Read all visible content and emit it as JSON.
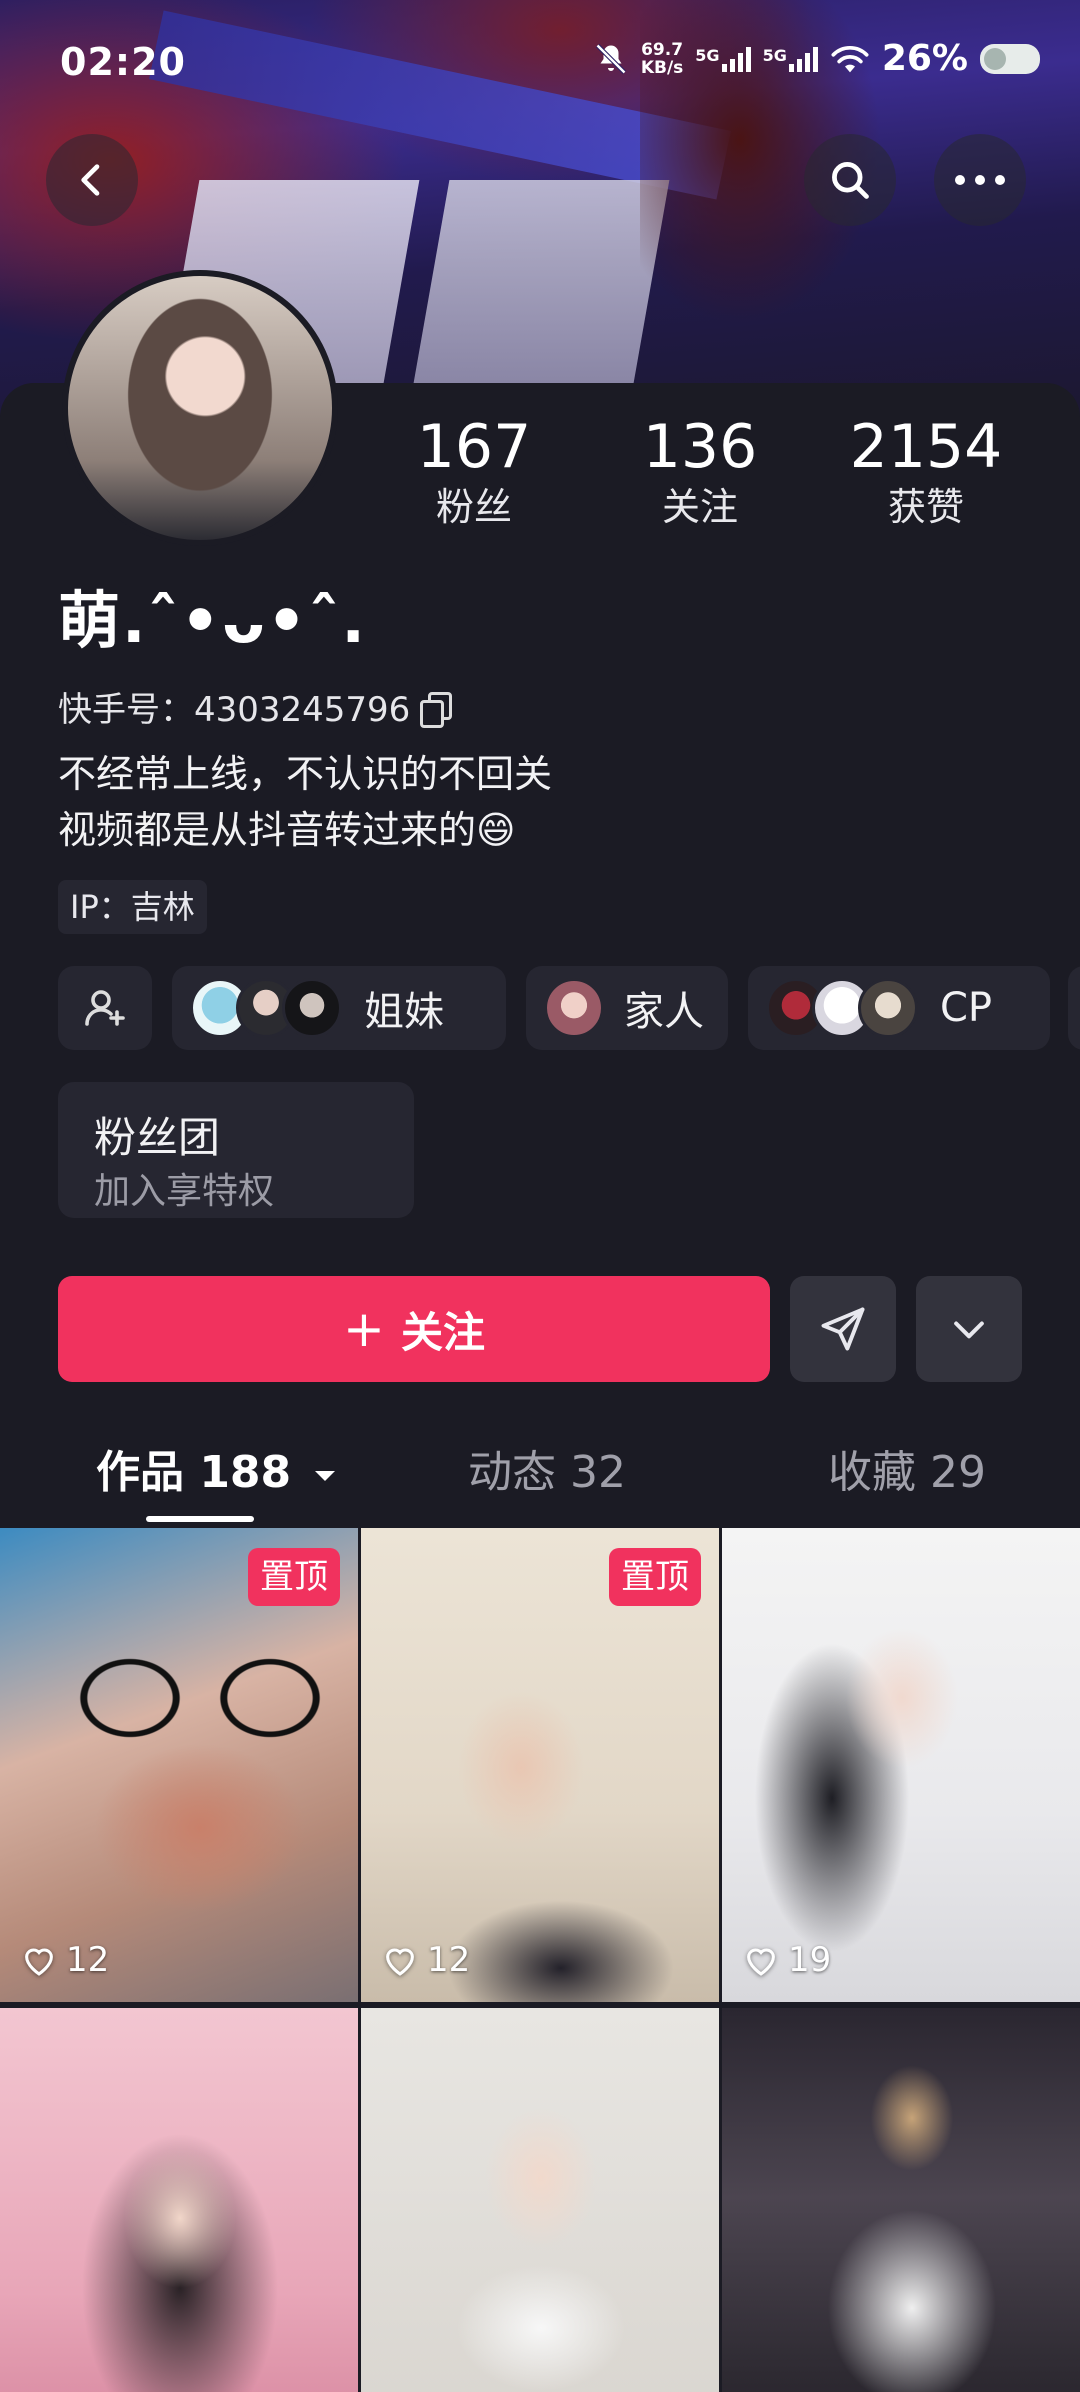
{
  "status_bar": {
    "time": "02:20",
    "net_speed_value": "69.7",
    "net_speed_unit": "KB/s",
    "network_1": "5G",
    "network_2": "5G",
    "battery_percent": "26%"
  },
  "profile": {
    "stats": [
      {
        "value": "167",
        "label": "粉丝"
      },
      {
        "value": "136",
        "label": "关注"
      },
      {
        "value": "2154",
        "label": "获赞"
      }
    ],
    "nickname": "萌.ˆ•ᴗ•ˆ.",
    "kuaishou_id": "快手号：4303245796",
    "bio_line1": "不经常上线，不认识的不回关",
    "bio_line2": "视频都是从抖音转过来的😄",
    "ip_location": "IP：吉林"
  },
  "relations": [
    {
      "label": "姐妹"
    },
    {
      "label": "家人"
    },
    {
      "label": "CP"
    }
  ],
  "fans_club": {
    "title": "粉丝团",
    "subtitle": "加入享特权"
  },
  "actions": {
    "follow_label": "关注",
    "follow_plus": "+"
  },
  "tabs": [
    {
      "label": "作品 188"
    },
    {
      "label": "动态 32"
    },
    {
      "label": "收藏 29"
    }
  ],
  "videos": [
    {
      "pinned_label": "置顶",
      "likes": "12"
    },
    {
      "pinned_label": "置顶",
      "likes": "12"
    },
    {
      "pinned_label": "",
      "likes": "19"
    },
    {
      "pinned_label": "",
      "likes": ""
    },
    {
      "pinned_label": "",
      "likes": ""
    },
    {
      "pinned_label": "",
      "likes": ""
    }
  ],
  "colors": {
    "accent": "#f1325e",
    "background": "#1b1b24",
    "chip_background": "#262631"
  }
}
